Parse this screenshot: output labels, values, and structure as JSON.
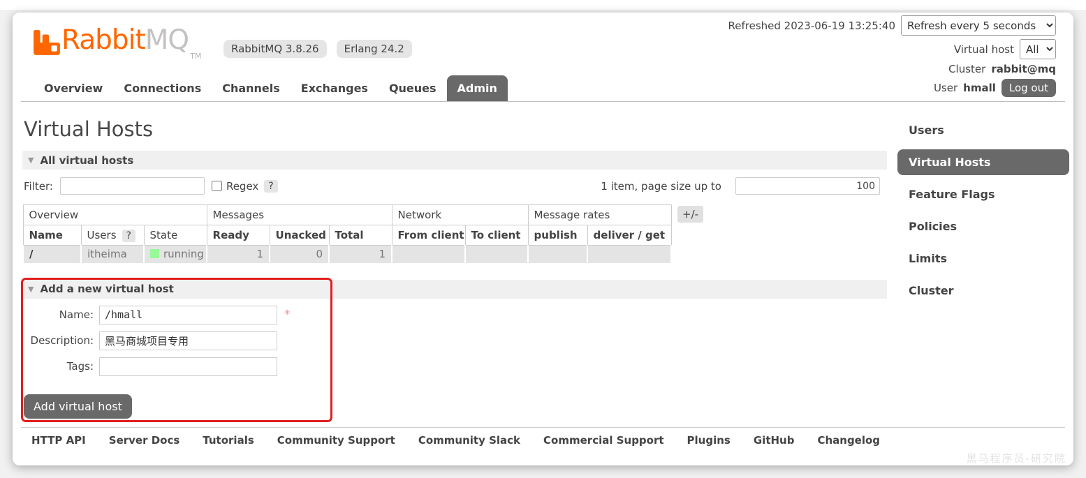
{
  "header": {
    "brand": {
      "rabbit": "Rabbit",
      "mq": "MQ",
      "tm": "TM"
    },
    "badges": {
      "rabbitmq_version": "RabbitMQ 3.8.26",
      "erlang_version": "Erlang 24.2"
    },
    "refreshed_text": "Refreshed 2023-06-19 13:25:40",
    "refresh_interval_option": "Refresh every 5 seconds",
    "virtual_host_label": "Virtual host",
    "virtual_host_option": "All",
    "cluster_label": "Cluster",
    "cluster_name": "rabbit@mq",
    "user_label": "User",
    "user_name": "hmall",
    "logout_label": "Log out"
  },
  "tabs": [
    {
      "label": "Overview",
      "selected": false
    },
    {
      "label": "Connections",
      "selected": false
    },
    {
      "label": "Channels",
      "selected": false
    },
    {
      "label": "Exchanges",
      "selected": false
    },
    {
      "label": "Queues",
      "selected": false
    },
    {
      "label": "Admin",
      "selected": true
    }
  ],
  "page_title": "Virtual Hosts",
  "all_hosts_section": {
    "title": "All virtual hosts"
  },
  "filter": {
    "label": "Filter:",
    "value": "",
    "regex_label": "Regex",
    "regex_help": "?",
    "pagination_text": "1 item, page size up to",
    "page_size_value": "100"
  },
  "table": {
    "group_headers": {
      "overview": "Overview",
      "messages": "Messages",
      "network": "Network",
      "message_rates": "Message rates"
    },
    "column_toggle": "+/-",
    "columns": {
      "name": "Name",
      "users": "Users",
      "users_help": "?",
      "state": "State",
      "ready": "Ready",
      "unacked": "Unacked",
      "total": "Total",
      "from_client": "From client",
      "to_client": "To client",
      "publish": "publish",
      "deliver_get": "deliver / get"
    },
    "rows": [
      {
        "name": "/",
        "users": "itheima",
        "state": "running",
        "ready": "1",
        "unacked": "0",
        "total": "1",
        "from_client": "",
        "to_client": "",
        "publish": "",
        "deliver_get": ""
      }
    ]
  },
  "add_host_section": {
    "title": "Add a new virtual host",
    "name_label": "Name:",
    "name_value": "/hmall",
    "required_marker": "*",
    "description_label": "Description:",
    "description_value": "黑马商城项目专用",
    "tags_label": "Tags:",
    "tags_value": "",
    "submit_label": "Add virtual host"
  },
  "sidebar": {
    "items": [
      {
        "label": "Users",
        "selected": false
      },
      {
        "label": "Virtual Hosts",
        "selected": true
      },
      {
        "label": "Feature Flags",
        "selected": false
      },
      {
        "label": "Policies",
        "selected": false
      },
      {
        "label": "Limits",
        "selected": false
      },
      {
        "label": "Cluster",
        "selected": false
      }
    ]
  },
  "footer": {
    "links": [
      "HTTP API",
      "Server Docs",
      "Tutorials",
      "Community Support",
      "Community Slack",
      "Commercial Support",
      "Plugins",
      "GitHub",
      "Changelog"
    ]
  },
  "watermark": "黑马程序员-研究院",
  "colors": {
    "brand_orange": "#ff6600",
    "selected_gray": "#696969",
    "status_green": "#98f998",
    "annotation_red": "#e01f1f"
  }
}
